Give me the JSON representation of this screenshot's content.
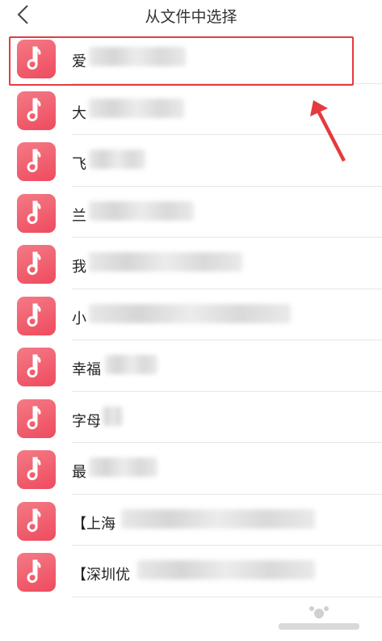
{
  "header": {
    "title": "从文件中选择",
    "back_icon": "chevron-left-icon"
  },
  "files": [
    {
      "label": "爱"
    },
    {
      "label": "大"
    },
    {
      "label": "飞"
    },
    {
      "label": "兰"
    },
    {
      "label": "我"
    },
    {
      "label": "小"
    },
    {
      "label": "幸福"
    },
    {
      "label": "字母"
    },
    {
      "label": "最"
    },
    {
      "label": "【上海"
    },
    {
      "label": "【深圳优"
    }
  ],
  "colors": {
    "icon_start": "#f47a86",
    "icon_end": "#ee4b5e",
    "annotation": "#e43b3f"
  },
  "icons": {
    "file_icon": "music-note-icon",
    "annotation_arrow": "arrow-icon"
  }
}
